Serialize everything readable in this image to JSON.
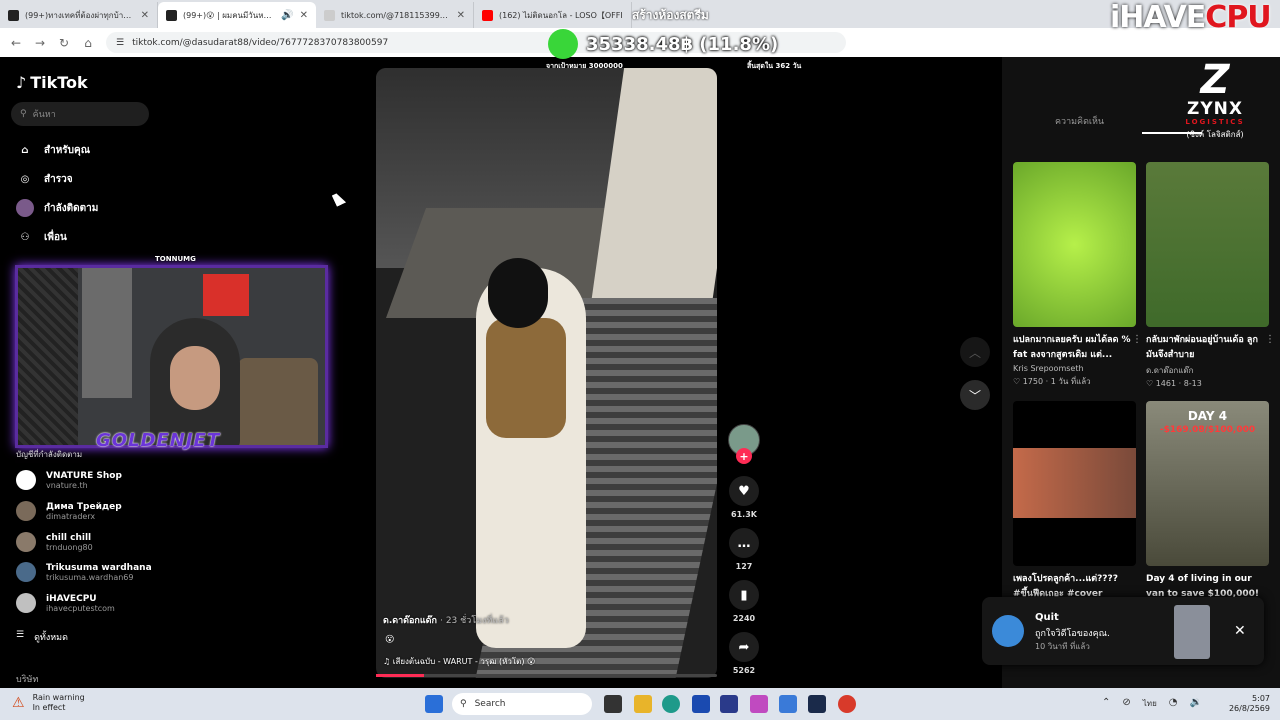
{
  "browser": {
    "tabs": [
      {
        "title": "(99+)ทางเทคที่ต้องผ่าทุกบ้าน | yadab",
        "active": false,
        "color": "#222222"
      },
      {
        "title": "(99+)😮 | ผมคนมีวันหาย | Ti",
        "active": true,
        "color": "#222222"
      },
      {
        "title": "tiktok.com/@7181153997444",
        "active": false,
        "color": "#888888"
      },
      {
        "title": "(162) ไม่ติดนอกโล - LOSO【OFFI",
        "active": false,
        "color": "#ff0000"
      }
    ],
    "url": "tiktok.com/@dasudarat88/video/7677728370783800597"
  },
  "overlay": {
    "room_title": "สร้างห้องสตรีม",
    "price": "35338.48฿ (11.8%)",
    "brand_a": "iHAVE",
    "brand_b": "CPU",
    "video_top_left": "จากเป้าหมาย 3000000",
    "video_top_right": "สิ้นสุดใน 362 วัน",
    "cam_tag": "TONNUMG",
    "cam_name": "GOLDENJET"
  },
  "tiktok": {
    "logo": "TikTok",
    "search_placeholder": "ค้นหา",
    "menu": [
      {
        "label": "สำหรับคุณ",
        "icon": "home-icon"
      },
      {
        "label": "สำรวจ",
        "icon": "compass-icon"
      },
      {
        "label": "กำลังติดตาม",
        "icon": "following-avatar-icon"
      },
      {
        "label": "เพื่อน",
        "icon": "friends-icon"
      }
    ],
    "following_title": "บัญชีที่กำลังติดตาม",
    "accounts": [
      {
        "name": "VNATURE Shop",
        "handle": "vnature.th",
        "color": "#ffffff"
      },
      {
        "name": "Дима Трейдер",
        "handle": "dimatraderx",
        "color": "#7a6a5a"
      },
      {
        "name": "chill chill",
        "handle": "trnduong80",
        "color": "#8a7a6a"
      },
      {
        "name": "Trikusuma wardhana",
        "handle": "trikusuma.wardhan69",
        "color": "#4a6a8a"
      },
      {
        "name": "iHAVECPU",
        "handle": "ihavecputestcom",
        "color": "#c0c0c0"
      }
    ],
    "see_all": "ดูทั้งหมด",
    "company": "บริษัท",
    "video": {
      "author": "ด.ดาด๊อกแด๊ก",
      "time_ago": "· 23 ชั่วโมงที่แล้ว",
      "emoji": "😮",
      "sound": "เสียงต้นฉบับ - WARUT",
      "sound_tail": "- วรุฒ (หัวโต) 😮",
      "progress": 0.14
    },
    "actions": {
      "likes": "61.3K",
      "comments": "127",
      "saves": "2240",
      "shares": "5262"
    },
    "right_panel": {
      "tab_label": "ความคิดเห็น",
      "zynx_name": "ZYNX",
      "zynx_sub": "LOGISTICS",
      "zynx_thai": "(ซิงค์ โลจิสติกส์)",
      "cards": [
        {
          "caption": "แปลกมากเลยครับ ผมได้ลด % fat ลงจากสูตรเดิม แต่...",
          "author": "Kris Srepoomseth",
          "meta": "♡ 1750 · 1 วัน ที่แล้ว",
          "color": "#8ad12a"
        },
        {
          "caption": "กลับมาพักผ่อนอยู่บ้านเด้อ ลูกมันจึงสำบาย",
          "author": "ด.ดาด๊อกแด๊ก",
          "meta": "♡ 1461 · 8-13",
          "color": "#5f8a3a"
        },
        {
          "caption": "เพลงโปรดลูกค้า...แต่???? #ขึ้นฟีดเถอะ #cover",
          "author": "",
          "meta": "",
          "color": "#7a4a3a"
        },
        {
          "caption": "Day 4 of living in our van to save $100,000!",
          "author": "",
          "meta": "",
          "color": "#6a6a5a",
          "thumb_title": "DAY 4",
          "thumb_sub": "-$169.08/$100,000"
        }
      ]
    },
    "toast": {
      "title": "Quit",
      "text": "ถูกใจวิดีโอของคุณ.",
      "time": "10 วินาที ที่แล้ว"
    }
  },
  "taskbar": {
    "weather_title": "Rain warning",
    "weather_sub": "In effect",
    "search": "Search",
    "lang": "ไทย",
    "time": "5:07",
    "date": "26/8/2569"
  }
}
